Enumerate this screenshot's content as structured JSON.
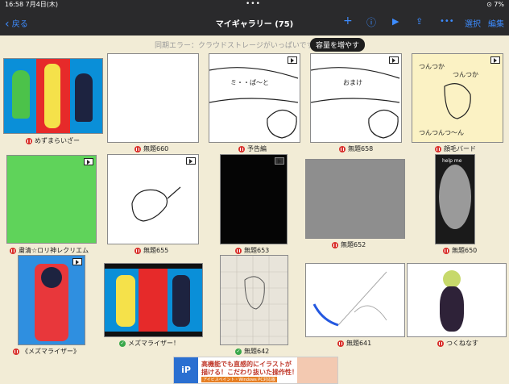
{
  "status_bar": {
    "time": "16:58",
    "date": "7月4日(木)",
    "right": "⊙ 7%"
  },
  "nav": {
    "back_label": "戻る",
    "title": "マイギャラリー (75)",
    "select_label": "選択",
    "edit_label": "編集"
  },
  "banner": {
    "message": "同期エラー：クラウドストレージがいっぱいです",
    "button": "容量を増やす"
  },
  "tiles": [
    {
      "label": "めずまらいざー"
    },
    {
      "label": "無題660"
    },
    {
      "label": "予告編"
    },
    {
      "label": "無題658"
    },
    {
      "label": "顔毛バード"
    },
    {
      "label": "粛清☆ロリ神レクリエム"
    },
    {
      "label": "無題655"
    },
    {
      "label": "無題653"
    },
    {
      "label": "無題652"
    },
    {
      "label": "無題650"
    },
    {
      "label": "《メズマライザー》"
    },
    {
      "label": "メズマライザー！"
    },
    {
      "label": "無題642"
    },
    {
      "label": "無題641"
    },
    {
      "label": "つくねなす"
    }
  ],
  "thumb_text": {
    "t3_top": "ミ・・ぱ～と",
    "t4_top": "おまけ",
    "t5_lines": [
      "つんつか",
      "つんつか",
      "つんつんつ～ん"
    ],
    "t10_top": "help me"
  },
  "ad": {
    "logo": "iP",
    "line1": "高機能でも直感的にイラストが",
    "line2": "描ける！こだわり抜いた操作性！",
    "line3": "アイビスペイント・Windows PC対応版"
  },
  "colors": {
    "accent": "#3d8cff",
    "error": "#d9302c",
    "ok": "#3aa84b",
    "background": "#f2ecd6"
  }
}
